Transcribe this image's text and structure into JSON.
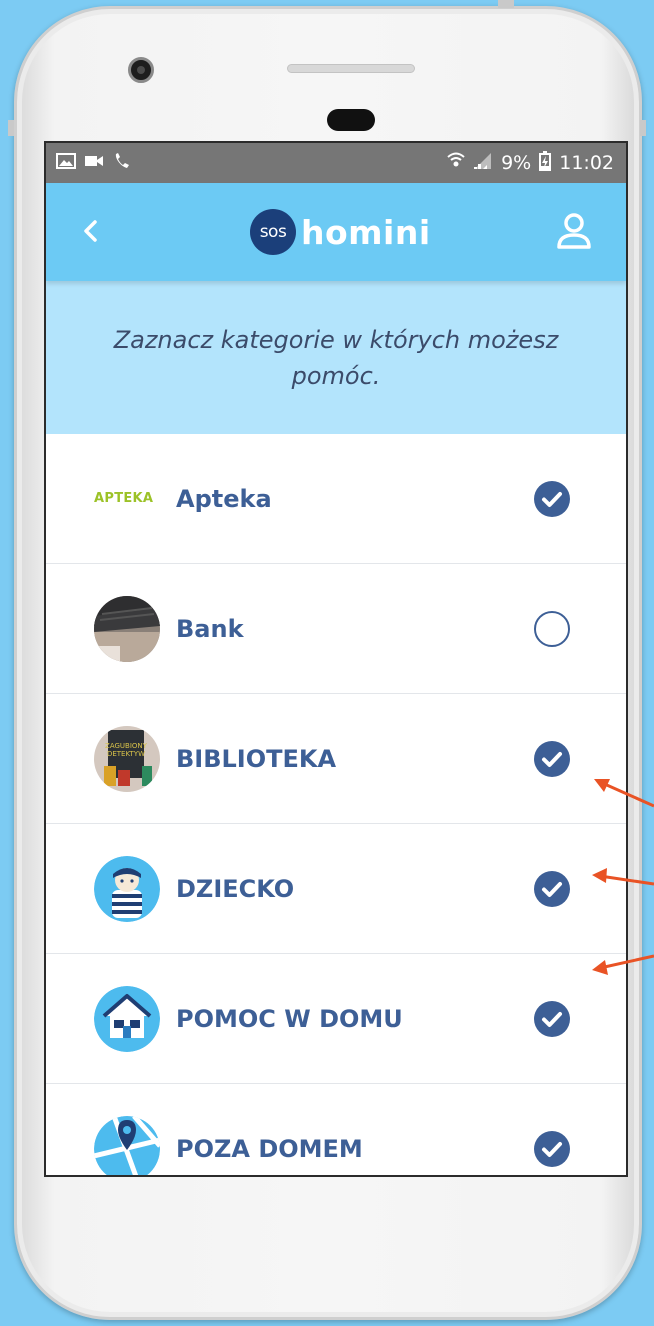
{
  "status_bar": {
    "left_icons": [
      "image-icon",
      "video-icon",
      "call-icon"
    ],
    "right_icons": [
      "wifi-call-icon",
      "signal-icon",
      "battery-charging-icon"
    ],
    "battery": "9%",
    "time": "11:02"
  },
  "header": {
    "logo_badge": "sos",
    "logo_text": "homini",
    "back_icon": "chevron-left-icon",
    "profile_icon": "user-icon"
  },
  "banner": {
    "text": "Zaznacz kategorie w których możesz pomóc."
  },
  "categories": [
    {
      "label": "Apteka",
      "icon_text": "APTEKA",
      "checked": true
    },
    {
      "label": "Bank",
      "icon": "bank-photo-icon",
      "checked": false
    },
    {
      "label": "BIBLIOTEKA",
      "icon": "books-photo-icon",
      "checked": true
    },
    {
      "label": "DZIECKO",
      "icon": "child-icon",
      "checked": true
    },
    {
      "label": "POMOC W DOMU",
      "icon": "house-icon",
      "checked": true
    },
    {
      "label": "POZA DOMEM",
      "icon": "map-pin-icon",
      "checked": true
    }
  ],
  "colors": {
    "page_bg": "#7ccbf3",
    "header_bg": "#6ccaf4",
    "banner_bg": "#b3e4fc",
    "accent": "#3d5f96",
    "logo_badge": "#1b3f7a",
    "arrow": "#e95325"
  }
}
